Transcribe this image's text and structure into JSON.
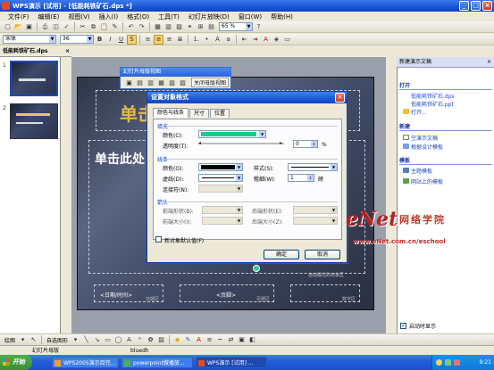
{
  "window": {
    "title": "WPS演示 [试用] - [低能耗铁矿石.dps *]"
  },
  "menus": [
    "文件(F)",
    "编辑(E)",
    "视图(V)",
    "插入(I)",
    "格式(O)",
    "工具(T)",
    "幻灯片放映(D)",
    "窗口(W)",
    "帮助(H)"
  ],
  "menu_right": "",
  "toolbar": {
    "zoom": "65 %",
    "font": "宋体",
    "size": "36"
  },
  "left_pane": {
    "tab": "低能耗铁矿石.dps",
    "slide_numbers": [
      "1",
      "2"
    ]
  },
  "master_toolbar": {
    "title": "幻灯片母版视图",
    "close_label": "关闭母版视图"
  },
  "slide": {
    "title_placeholder": "单击",
    "body_placeholder": "单击此处",
    "footer_date": "<日期/时间>",
    "footer_area_date": "日期区",
    "footer_mid": "<页脚>",
    "footer_area_mid": "页脚区",
    "footer_area_num": "数字区",
    "autolayout_label": "自动版式的对象区"
  },
  "dialog": {
    "title": "设置对象格式",
    "tabs": [
      "颜色与线条",
      "尺寸",
      "位置"
    ],
    "fill_section": "填充",
    "color_label": "颜色(C):",
    "transparency_label": "透明度(T):",
    "transparency_value": "0",
    "transparency_unit": "%",
    "line_section": "线条",
    "line_color_label": "颜色(O):",
    "dash_label": "虚线(D):",
    "connector_label": "连接符(N):",
    "style_label": "样式(S):",
    "weight_label": "粗细(W):",
    "weight_value": "1",
    "weight_unit": "磅",
    "arrow_section": "箭头",
    "begin_style_label": "前端形状(B):",
    "begin_size_label": "前端大小(I):",
    "end_style_label": "后端形状(E):",
    "end_size_label": "后端大小(Z):",
    "default_checkbox": "新对象默认值(F)",
    "ok": "确定",
    "cancel": "取消",
    "fill_color": "#1ec88f",
    "line_color": "#000000"
  },
  "task_pane": {
    "title": "新建演示文稿",
    "open_section": "打开",
    "recent": [
      "低能耗铁矿石.dps",
      "低能耗铁矿石.ppt"
    ],
    "open_more": "打开...",
    "new_section": "新建",
    "new_items": [
      "空演示文稿",
      "根据设计模板"
    ],
    "template_section": "模板",
    "template_items": [
      "主题模板",
      "网站上的模板"
    ],
    "show_on_startup": "启动时显示"
  },
  "draw_toolbar": {
    "draw": "绘图",
    "autoshapes": "自选图形"
  },
  "status_bar": {
    "view": "幻灯片母版",
    "theme": "bluedh"
  },
  "taskbar": {
    "start": "开始",
    "items": [
      "WPS2005演示目完...",
      "powerpoint做播放...",
      "WPS演示 [试用] ..."
    ],
    "clock": "9:21"
  },
  "watermark": {
    "logo": "eNet",
    "cn": "网络学院",
    "url": "www.eNet.com.cn/eschool"
  }
}
